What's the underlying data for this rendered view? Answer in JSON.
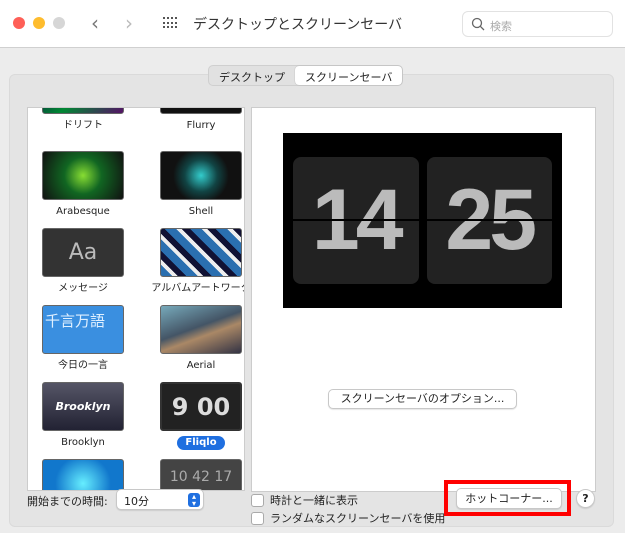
{
  "window": {
    "title": "デスクトップとスクリーンセーバ",
    "search_placeholder": "検索"
  },
  "tabs": [
    {
      "label": "デスクトップ",
      "selected": false
    },
    {
      "label": "スクリーンセーバ",
      "selected": true
    }
  ],
  "savers": [
    {
      "label": "ドリフト"
    },
    {
      "label": "Flurry"
    },
    {
      "label": "Arabesque"
    },
    {
      "label": "Shell"
    },
    {
      "label": "メッセージ",
      "thumb_text": "Aa"
    },
    {
      "label": "アルバムアートワーク"
    },
    {
      "label": "今日の一言",
      "thumb_text": "千言万語"
    },
    {
      "label": "Aerial"
    },
    {
      "label": "Brooklyn",
      "thumb_text": "Brooklyn"
    },
    {
      "label": "Fliqlo",
      "thumb_text": "9 00",
      "selected": true
    },
    {
      "label": ""
    },
    {
      "label": "",
      "thumb_text": "10 42 17"
    }
  ],
  "preview": {
    "hours": "14",
    "minutes": "25",
    "options_button": "スクリーンセーバのオプション..."
  },
  "bottom": {
    "start_label": "開始までの時間:",
    "start_value": "10分",
    "show_clock": "時計と一緒に表示",
    "random": "ランダムなスクリーンセーバを使用",
    "hot_corners": "ホットコーナー...",
    "help": "?"
  },
  "colors": {
    "accent": "#1f6fe0",
    "highlight": "#ff0000"
  }
}
